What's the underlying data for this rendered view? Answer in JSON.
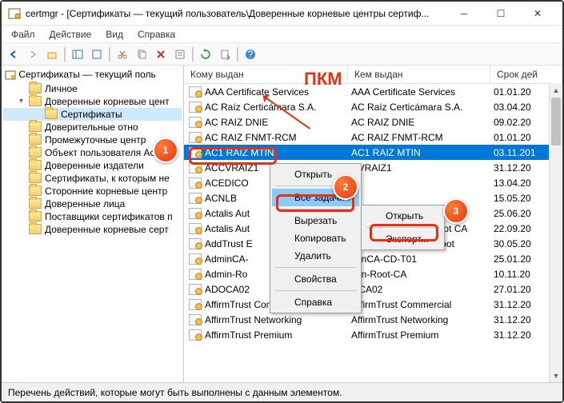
{
  "window": {
    "title": "certmgr - [Сертификаты — текущий пользователь\\Доверенные корневые центры сертиф..."
  },
  "menubar": {
    "file": "Файл",
    "action": "Действие",
    "view": "Вид",
    "help": "Справка"
  },
  "tree": {
    "root": "Сертификаты — текущий поль",
    "items": [
      {
        "label": "Личное"
      },
      {
        "label": "Доверенные корневые цент",
        "expanded": true,
        "children": [
          {
            "label": "Сертификаты",
            "selected": true
          }
        ]
      },
      {
        "label": "Доверительные отно"
      },
      {
        "label": "Промежуточные центр"
      },
      {
        "label": "Объект пользователя Active"
      },
      {
        "label": "Доверенные издатели"
      },
      {
        "label": "Сертификаты, к которым не"
      },
      {
        "label": "Сторонние корневые центр"
      },
      {
        "label": "Доверенные лица"
      },
      {
        "label": "Поставщики сертификатов п"
      },
      {
        "label": "Доверенные корневые серт"
      }
    ]
  },
  "columns": {
    "c1": "Кому выдан",
    "c2": "Кем выдан",
    "c3": "Срок дей"
  },
  "rows": [
    {
      "a": "AAA Certificate Services",
      "b": "AAA Certificate Services",
      "c": "01.01.20"
    },
    {
      "a": "AC Raíz Certicámara S.A.",
      "b": "AC Raíz Certicámara S.A.",
      "c": "03.04.20"
    },
    {
      "a": "AC RAIZ DNIE",
      "b": "AC RAIZ DNIE",
      "c": "09.02.20"
    },
    {
      "a": "AC RAIZ FNMT-RCM",
      "b": "AC RAIZ FNMT-RCM",
      "c": "01.01.20"
    },
    {
      "a": "AC1 RAIZ MTIN",
      "b": "AC1 RAIZ MTIN",
      "c": "03.11.201",
      "selected": true
    },
    {
      "a": "ACCVRAIZ1",
      "b": "CVRAIZ1",
      "c": "31.12.20"
    },
    {
      "a": "ACEDICO",
      "b": "",
      "c": "13.04.20"
    },
    {
      "a": "ACNLB",
      "b": "",
      "c": "15.05.20"
    },
    {
      "a": "Actalis Aut",
      "b": "",
      "c": "25.06.20"
    },
    {
      "a": "Actalis Aut",
      "b": "alis Authentication Root CA",
      "c": "22.09.20"
    },
    {
      "a": "AddTrust E",
      "b": "dTrust External CA Root",
      "c": "30.05.20"
    },
    {
      "a": "AdminCA-",
      "b": "minCA-CD-T01",
      "c": "25.01.20"
    },
    {
      "a": "Admin-Ro",
      "b": "min-Root-CA",
      "c": "10.11.20"
    },
    {
      "a": "ADOCA02",
      "b": "OCA02",
      "c": "27.01.20"
    },
    {
      "a": "AffirmTrust Commercial",
      "b": "AffirmTrust Commercial",
      "c": "31.12.20"
    },
    {
      "a": "AffirmTrust Networking",
      "b": "AffirmTrust Networking",
      "c": "31.12.20"
    },
    {
      "a": "AffirmTrust Premium",
      "b": "AffirmTrust Premium",
      "c": "31.12.20"
    }
  ],
  "ctx": {
    "open": "Открыть",
    "alltasks": "Все задачи",
    "cut": "Вырезать",
    "copy": "Копировать",
    "delete": "Удалить",
    "props": "Свойства",
    "help": "Справка",
    "sub_open": "Открыть",
    "sub_export": "Экспорт..."
  },
  "status": "Перечень действий, которые могут быть выполнены с данным элементом.",
  "annotation": {
    "pkm": "ПКМ",
    "b1": "1",
    "b2": "2",
    "b3": "3"
  }
}
